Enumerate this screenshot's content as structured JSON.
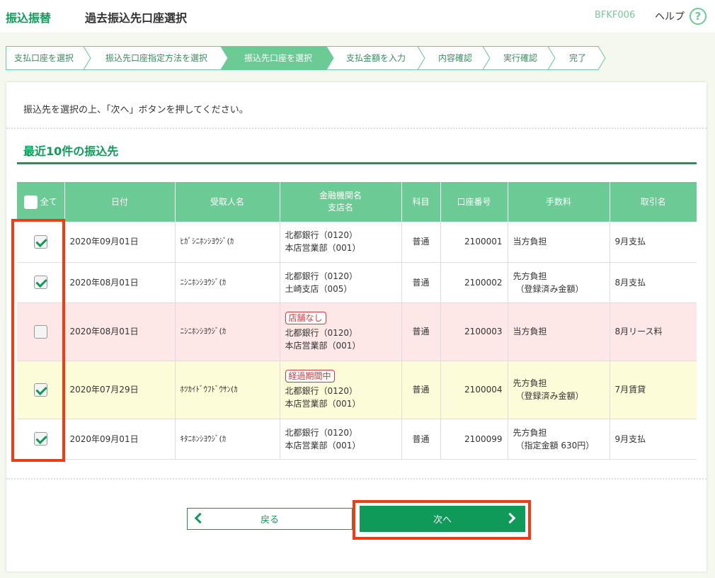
{
  "header": {
    "category": "振込振替",
    "title": "過去振込先口座選択",
    "screen_code": "BFKF006",
    "help_label": "ヘルプ",
    "help_icon": "?"
  },
  "steps": [
    "支払口座を選択",
    "振込先口座指定方法を選択",
    "振込先口座を選択",
    "支払金額を入力",
    "内容確認",
    "実行確認",
    "完了"
  ],
  "active_step": 2,
  "instruction": "振込先を選択の上、「次へ」ボタンを押してください。",
  "section_title": "最近10件の振込先",
  "table": {
    "select_all_label": "全て",
    "headers": {
      "date": "日付",
      "payee": "受取人名",
      "bank_line1": "金融機関名",
      "bank_line2": "支店名",
      "type": "科目",
      "account": "口座番号",
      "fee": "手数料",
      "memo": "取引名"
    },
    "rows": [
      {
        "checked": true,
        "date": "2020年09月01日",
        "payee": "ﾋｶﾞｼﾆﾎﾝｼﾖｳｼﾞ(ｶ",
        "badge": "",
        "bank": "北都銀行（0120）",
        "branch": "本店営業部（001）",
        "type": "普通",
        "account": "2100001",
        "fee1": "当方負担",
        "fee2": "",
        "memo": "9月支払"
      },
      {
        "checked": true,
        "date": "2020年08月01日",
        "payee": "ﾆｼﾆﾎﾝｼﾖｳｼﾞ(ｶ",
        "badge": "",
        "bank": "北都銀行（0120）",
        "branch": "土崎支店（005）",
        "type": "普通",
        "account": "2100002",
        "fee1": "先方負担",
        "fee2": "（登録済み金額）",
        "memo": "8月支払"
      },
      {
        "checked": false,
        "date": "2020年08月01日",
        "payee": "ﾆｼﾆﾎﾝｼﾖｳｼﾞ(ｶ",
        "badge": "店舗なし",
        "bank": "北都銀行（0120）",
        "branch": "本店営業部（001）",
        "type": "普通",
        "account": "2100003",
        "fee1": "当方負担",
        "fee2": "",
        "memo": "8月リース料"
      },
      {
        "checked": true,
        "date": "2020年07月29日",
        "payee": "ﾎﾂｶｲﾄﾞｳﾌﾄﾞｳｻﾝ(ｶ",
        "badge": "経過期間中",
        "bank": "北都銀行（0120）",
        "branch": "本店営業部（001）",
        "type": "普通",
        "account": "2100004",
        "fee1": "先方負担",
        "fee2": "（登録済み金額）",
        "memo": "7月賃貸"
      },
      {
        "checked": true,
        "date": "2020年09月01日",
        "payee": "ｷﾀﾆﾎﾝｼﾖｳｼﾞ(ｶ",
        "badge": "",
        "bank": "北都銀行（0120）",
        "branch": "本店営業部（001）",
        "type": "普通",
        "account": "2100099",
        "fee1": "先方負担",
        "fee2": "（指定金額 630円）",
        "memo": "9月支払"
      }
    ]
  },
  "buttons": {
    "back_label": "戻る",
    "next_label": "次へ"
  },
  "colors": {
    "brand_green": "#0f9a5a",
    "header_green": "#6ccb95",
    "highlight_red": "#f03c12"
  }
}
